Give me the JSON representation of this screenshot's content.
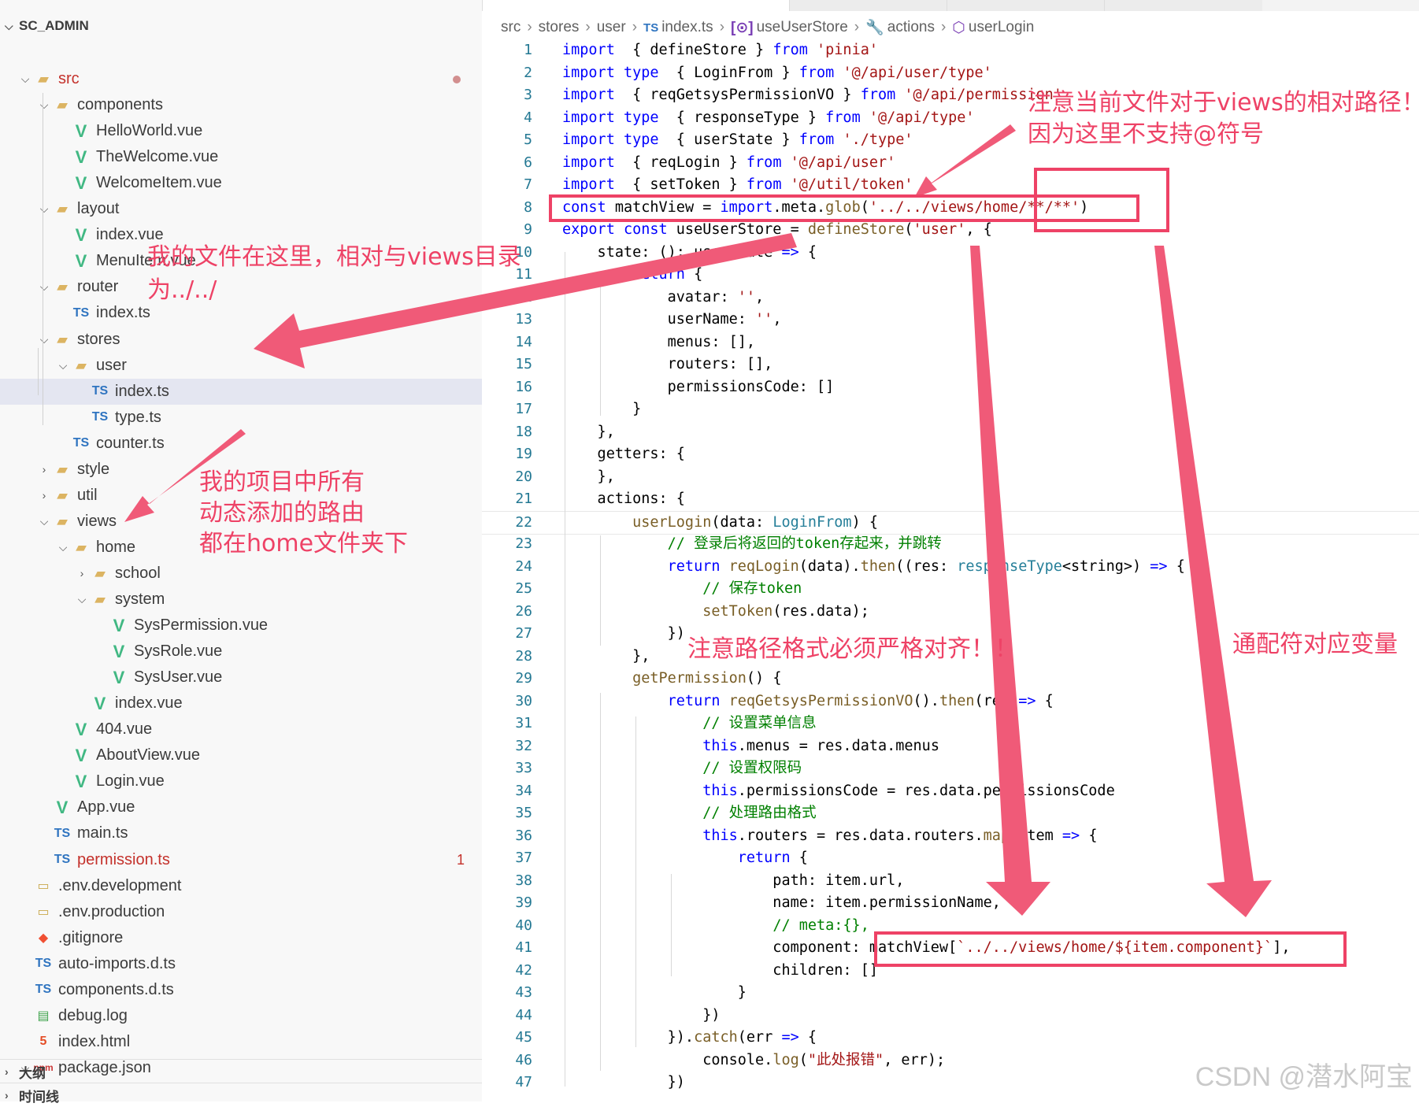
{
  "explorer": {
    "title": "SC_ADMIN",
    "items": [
      {
        "label": "src",
        "icon": "folder-src-icon",
        "kind": "folder"
      },
      {
        "label": "components",
        "icon": "folder-components-icon",
        "kind": "folder"
      },
      {
        "label": "HelloWorld.vue",
        "icon": "vue-file-icon",
        "kind": "vue"
      },
      {
        "label": "TheWelcome.vue",
        "icon": "vue-file-icon",
        "kind": "vue"
      },
      {
        "label": "WelcomeItem.vue",
        "icon": "vue-file-icon",
        "kind": "vue"
      },
      {
        "label": "layout",
        "icon": "folder-layout-icon",
        "kind": "folder"
      },
      {
        "label": "index.vue",
        "icon": "vue-file-icon",
        "kind": "vue"
      },
      {
        "label": "MenuItem.vue",
        "icon": "vue-file-icon",
        "kind": "vue"
      },
      {
        "label": "router",
        "icon": "folder-router-icon",
        "kind": "folder"
      },
      {
        "label": "index.ts",
        "icon": "ts-file-icon",
        "kind": "ts"
      },
      {
        "label": "stores",
        "icon": "folder-stores-icon",
        "kind": "folder"
      },
      {
        "label": "user",
        "icon": "folder-user-icon",
        "kind": "folder"
      },
      {
        "label": "index.ts",
        "icon": "ts-file-icon",
        "kind": "ts"
      },
      {
        "label": "type.ts",
        "icon": "ts-file-icon",
        "kind": "ts"
      },
      {
        "label": "counter.ts",
        "icon": "ts-file-icon",
        "kind": "ts"
      },
      {
        "label": "style",
        "icon": "folder-style-icon",
        "kind": "folder"
      },
      {
        "label": "util",
        "icon": "folder-util-icon",
        "kind": "folder"
      },
      {
        "label": "views",
        "icon": "folder-views-icon",
        "kind": "folder"
      },
      {
        "label": "home",
        "icon": "folder-home-icon",
        "kind": "folder"
      },
      {
        "label": "school",
        "icon": "folder-school-icon",
        "kind": "folder"
      },
      {
        "label": "system",
        "icon": "folder-system-icon",
        "kind": "folder"
      },
      {
        "label": "SysPermission.vue",
        "icon": "vue-file-icon",
        "kind": "vue"
      },
      {
        "label": "SysRole.vue",
        "icon": "vue-file-icon",
        "kind": "vue"
      },
      {
        "label": "SysUser.vue",
        "icon": "vue-file-icon",
        "kind": "vue"
      },
      {
        "label": "index.vue",
        "icon": "vue-file-icon",
        "kind": "vue"
      },
      {
        "label": "404.vue",
        "icon": "vue-file-icon",
        "kind": "vue"
      },
      {
        "label": "AboutView.vue",
        "icon": "vue-file-icon",
        "kind": "vue"
      },
      {
        "label": "Login.vue",
        "icon": "vue-file-icon",
        "kind": "vue"
      },
      {
        "label": "App.vue",
        "icon": "vue-file-icon",
        "kind": "vue"
      },
      {
        "label": "main.ts",
        "icon": "ts-file-icon",
        "kind": "ts"
      },
      {
        "label": "permission.ts",
        "icon": "ts-file-icon",
        "kind": "ts",
        "badge": "1"
      },
      {
        "label": ".env.development",
        "icon": "env-file-icon",
        "kind": "env"
      },
      {
        "label": ".env.production",
        "icon": "env-file-icon",
        "kind": "env"
      },
      {
        "label": ".gitignore",
        "icon": "git-file-icon",
        "kind": "git"
      },
      {
        "label": "auto-imports.d.ts",
        "icon": "ts-file-icon",
        "kind": "ts"
      },
      {
        "label": "components.d.ts",
        "icon": "ts-file-icon",
        "kind": "ts"
      },
      {
        "label": "debug.log",
        "icon": "log-file-icon",
        "kind": "log"
      },
      {
        "label": "index.html",
        "icon": "html-file-icon",
        "kind": "html"
      },
      {
        "label": "package.json",
        "icon": "json-file-icon",
        "kind": "json"
      }
    ],
    "outline_label": "大纲",
    "timeline_label": "时间线"
  },
  "breadcrumb": {
    "items": [
      "src",
      "stores",
      "user",
      "index.ts",
      "useUserStore",
      "actions",
      "userLogin"
    ],
    "ts_badge": "TS"
  },
  "editor": {
    "lines": [
      {
        "n": "1",
        "segs": [
          [
            "k",
            "import"
          ],
          [
            "",
            "  { defineStore } "
          ],
          [
            "k",
            "from"
          ],
          [
            "s",
            " 'pinia'"
          ]
        ]
      },
      {
        "n": "2",
        "segs": [
          [
            "k",
            "import type"
          ],
          [
            "",
            "  { LoginFrom } "
          ],
          [
            "k",
            "from"
          ],
          [
            "s",
            " '@/api/user/type'"
          ]
        ]
      },
      {
        "n": "3",
        "segs": [
          [
            "k",
            "import"
          ],
          [
            "",
            "  { reqGetsysPermissionVO } "
          ],
          [
            "k",
            "from"
          ],
          [
            "s",
            " '@/api/permission'"
          ]
        ]
      },
      {
        "n": "4",
        "segs": [
          [
            "k",
            "import type"
          ],
          [
            "",
            "  { responseType } "
          ],
          [
            "k",
            "from"
          ],
          [
            "s",
            " '@/api/type'"
          ]
        ]
      },
      {
        "n": "5",
        "segs": [
          [
            "k",
            "import type"
          ],
          [
            "",
            "  { userState } "
          ],
          [
            "k",
            "from"
          ],
          [
            "s",
            " './type'"
          ]
        ]
      },
      {
        "n": "6",
        "segs": [
          [
            "k",
            "import"
          ],
          [
            "",
            "  { reqLogin } "
          ],
          [
            "k",
            "from"
          ],
          [
            "s",
            " '@/api/user'"
          ]
        ]
      },
      {
        "n": "7",
        "segs": [
          [
            "k",
            "import"
          ],
          [
            "",
            "  { setToken } "
          ],
          [
            "k",
            "from"
          ],
          [
            "s",
            " '@/util/token'"
          ]
        ]
      },
      {
        "n": "8",
        "segs": [
          [
            "k",
            "const"
          ],
          [
            "",
            " matchView = "
          ],
          [
            "k",
            "import"
          ],
          [
            ".",
            ".meta."
          ],
          [
            "f",
            "glob"
          ],
          [
            "",
            "("
          ],
          [
            "s",
            "'../../views/home/**/**'"
          ],
          [
            "",
            ")"
          ]
        ]
      },
      {
        "n": "9",
        "segs": [
          [
            "k",
            "export const"
          ],
          [
            "",
            " useUserStore = "
          ],
          [
            "f",
            "defineStore"
          ],
          [
            "",
            "("
          ],
          [
            "s",
            "'user'"
          ],
          [
            "",
            ", {"
          ]
        ]
      },
      {
        "n": "10",
        "segs": [
          [
            "",
            "    state: (): userState "
          ],
          [
            "k",
            "=>"
          ],
          [
            "",
            " {"
          ]
        ]
      },
      {
        "n": "11",
        "segs": [
          [
            "",
            "        "
          ],
          [
            "k",
            "return"
          ],
          [
            "",
            " {"
          ]
        ]
      },
      {
        "n": "12",
        "segs": [
          [
            "",
            "            avatar: "
          ],
          [
            "s",
            "''"
          ],
          [
            "",
            ","
          ]
        ]
      },
      {
        "n": "13",
        "segs": [
          [
            "",
            "            userName: "
          ],
          [
            "s",
            "''"
          ],
          [
            "",
            ","
          ]
        ]
      },
      {
        "n": "14",
        "segs": [
          [
            "",
            "            menus: [],"
          ]
        ]
      },
      {
        "n": "15",
        "segs": [
          [
            "",
            "            routers: [],"
          ]
        ]
      },
      {
        "n": "16",
        "segs": [
          [
            "",
            "            permissionsCode: []"
          ]
        ]
      },
      {
        "n": "17",
        "segs": [
          [
            "",
            "        }"
          ]
        ]
      },
      {
        "n": "18",
        "segs": [
          [
            "",
            "    },"
          ]
        ]
      },
      {
        "n": "19",
        "segs": [
          [
            "",
            "    getters: {"
          ]
        ]
      },
      {
        "n": "20",
        "segs": [
          [
            "",
            "    },"
          ]
        ]
      },
      {
        "n": "21",
        "segs": [
          [
            "",
            "    actions: {"
          ]
        ]
      },
      {
        "n": "22",
        "segs": [
          [
            "",
            "        "
          ],
          [
            "f",
            "userLogin"
          ],
          [
            "",
            "(data: "
          ],
          [
            "t",
            "LoginFrom"
          ],
          [
            "",
            ") {"
          ]
        ]
      },
      {
        "n": "23",
        "segs": [
          [
            "",
            "            "
          ],
          [
            "c",
            "// 登录后将返回的token存起来，并跳转"
          ]
        ]
      },
      {
        "n": "24",
        "segs": [
          [
            "",
            "            "
          ],
          [
            "k",
            "return"
          ],
          [
            "",
            " "
          ],
          [
            "f",
            "reqLogin"
          ],
          [
            "",
            "(data)."
          ],
          [
            "f",
            "then"
          ],
          [
            "",
            "((res: "
          ],
          [
            "t",
            "responseType"
          ],
          [
            "",
            "<string>) "
          ],
          [
            "k",
            "=>"
          ],
          [
            "",
            " {"
          ]
        ]
      },
      {
        "n": "25",
        "segs": [
          [
            "",
            "                "
          ],
          [
            "c",
            "// 保存token"
          ]
        ]
      },
      {
        "n": "26",
        "segs": [
          [
            "",
            "                "
          ],
          [
            "f",
            "setToken"
          ],
          [
            "",
            "(res.data);"
          ]
        ]
      },
      {
        "n": "27",
        "segs": [
          [
            "",
            "            })"
          ]
        ]
      },
      {
        "n": "28",
        "segs": [
          [
            "",
            "        },"
          ]
        ]
      },
      {
        "n": "29",
        "segs": [
          [
            "",
            "        "
          ],
          [
            "f",
            "getPermission"
          ],
          [
            "",
            "() {"
          ]
        ]
      },
      {
        "n": "30",
        "segs": [
          [
            "",
            "            "
          ],
          [
            "k",
            "return"
          ],
          [
            "",
            " "
          ],
          [
            "f",
            "reqGetsysPermissionVO"
          ],
          [
            "",
            "()."
          ],
          [
            "f",
            "then"
          ],
          [
            "",
            "(res "
          ],
          [
            "k",
            "=>"
          ],
          [
            "",
            " {"
          ]
        ]
      },
      {
        "n": "31",
        "segs": [
          [
            "",
            "                "
          ],
          [
            "c",
            "// 设置菜单信息"
          ]
        ]
      },
      {
        "n": "32",
        "segs": [
          [
            "",
            "                "
          ],
          [
            "k",
            "this"
          ],
          [
            "",
            ".menus = res.data.menus"
          ]
        ]
      },
      {
        "n": "33",
        "segs": [
          [
            "",
            "                "
          ],
          [
            "c",
            "// 设置权限码"
          ]
        ]
      },
      {
        "n": "34",
        "segs": [
          [
            "",
            "                "
          ],
          [
            "k",
            "this"
          ],
          [
            "",
            ".permissionsCode = res.data.permissionsCode"
          ]
        ]
      },
      {
        "n": "35",
        "segs": [
          [
            "",
            "                "
          ],
          [
            "c",
            "// 处理路由格式"
          ]
        ]
      },
      {
        "n": "36",
        "segs": [
          [
            "",
            "                "
          ],
          [
            "k",
            "this"
          ],
          [
            "",
            ".routers = res.data.routers."
          ],
          [
            "f",
            "map"
          ],
          [
            "",
            "(item "
          ],
          [
            "k",
            "=>"
          ],
          [
            "",
            " {"
          ]
        ]
      },
      {
        "n": "37",
        "segs": [
          [
            "",
            "                    "
          ],
          [
            "k",
            "return"
          ],
          [
            "",
            " {"
          ]
        ]
      },
      {
        "n": "38",
        "segs": [
          [
            "",
            "                        path: item.url,"
          ]
        ]
      },
      {
        "n": "39",
        "segs": [
          [
            "",
            "                        name: item.permissionName,"
          ]
        ]
      },
      {
        "n": "40",
        "segs": [
          [
            "",
            "                        "
          ],
          [
            "c",
            "// meta:{},"
          ]
        ]
      },
      {
        "n": "41",
        "segs": [
          [
            "",
            "                        component: matchView["
          ],
          [
            "s",
            "`../../views/home/${item.component}`"
          ],
          [
            "",
            "],"
          ]
        ]
      },
      {
        "n": "42",
        "segs": [
          [
            "",
            "                        children: []"
          ]
        ]
      },
      {
        "n": "43",
        "segs": [
          [
            "",
            "                    }"
          ]
        ]
      },
      {
        "n": "44",
        "segs": [
          [
            "",
            "                })"
          ]
        ]
      },
      {
        "n": "45",
        "segs": [
          [
            "",
            "            })."
          ],
          [
            "f",
            "catch"
          ],
          [
            "",
            "(err "
          ],
          [
            "k",
            "=>"
          ],
          [
            "",
            " {"
          ]
        ]
      },
      {
        "n": "46",
        "segs": [
          [
            "",
            "                console."
          ],
          [
            "f",
            "log"
          ],
          [
            "",
            "("
          ],
          [
            "s",
            "\"此处报错\""
          ],
          [
            "",
            ", err);"
          ]
        ]
      },
      {
        "n": "47",
        "segs": [
          [
            "",
            "            })"
          ]
        ]
      }
    ]
  },
  "annotations": {
    "relative_path_note_line1": "注意当前文件对于views的相对路径！",
    "relative_path_note_line2": "因为这里不支持@符号",
    "file_location_line1": "我的文件在这里，相对与views目录",
    "file_location_line2": "为../../",
    "routes_note_line1": "我的项目中所有",
    "routes_note_line2": "动态添加的路由",
    "routes_note_line3": "都在home文件夹下",
    "path_format_note": "注意路径格式必须严格对齐！！",
    "wildcard_note": "通配符对应变量",
    "accent_color": "#ee4266"
  },
  "watermark": "CSDN @潜水阿宝"
}
